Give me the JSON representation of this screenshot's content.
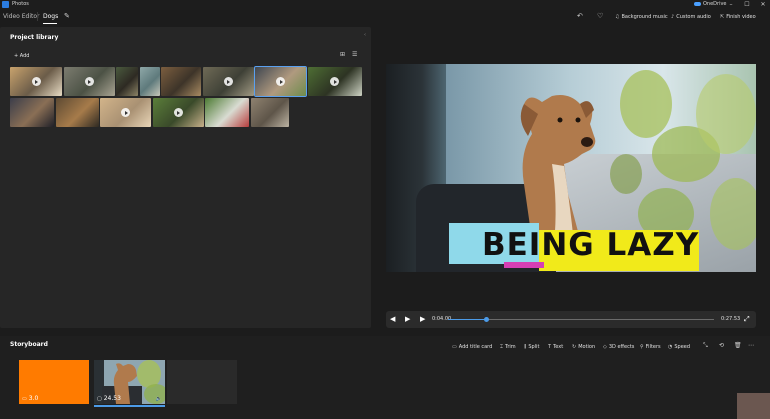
{
  "app": {
    "title": "Photos",
    "onedrive": "OneDrive"
  },
  "window_controls": {
    "minimize": "–",
    "maximize": "☐",
    "close": "✕"
  },
  "toolbar": {
    "breadcrumb_root": "Video Editor",
    "project_name": "Dogs",
    "undo_icon": "↶",
    "favorite_icon": "♡",
    "background_music": "Background music",
    "custom_audio": "Custom audio",
    "finish_video": "Finish video"
  },
  "library": {
    "title": "Project library",
    "add_label": "Add",
    "thumbnails": [
      {
        "colors": [
          "#c9a36d",
          "#6b5c49",
          "#e8dcc4"
        ],
        "play": true,
        "selected": false
      },
      {
        "colors": [
          "#7c7c70",
          "#4c5245",
          "#a9a493"
        ],
        "play": true,
        "selected": false
      },
      {
        "colors": [
          "#4a5a3e",
          "#2e2a23",
          "#8c8466"
        ],
        "play": false,
        "selected": false
      },
      {
        "colors": [
          "#8fa8a8",
          "#5e7a7c",
          "#c7c7b9"
        ],
        "play": false,
        "selected": false
      },
      {
        "colors": [
          "#7c5e3f",
          "#3d3429",
          "#a88a62"
        ],
        "play": false,
        "selected": false
      },
      {
        "colors": [
          "#6f6a56",
          "#3e4036",
          "#a19a84"
        ],
        "play": true,
        "selected": false
      },
      {
        "colors": [
          "#3e4650",
          "#b09a7f",
          "#6e8c4c"
        ],
        "play": true,
        "selected": true
      },
      {
        "colors": [
          "#4e6e34",
          "#2d3323",
          "#cfd4c5"
        ],
        "play": true,
        "selected": false
      },
      {
        "colors": [
          "#3b3d4a",
          "#8a6f55",
          "#1f2028"
        ],
        "play": false,
        "selected": false
      },
      {
        "colors": [
          "#5d4a33",
          "#a67b4a",
          "#2f2a22"
        ],
        "play": false,
        "selected": false
      },
      {
        "colors": [
          "#d2b48a",
          "#a99173",
          "#e9d6b8"
        ],
        "play": true,
        "selected": false
      },
      {
        "colors": [
          "#5b7e3a",
          "#3a4a2a",
          "#c7b08a"
        ],
        "play": true,
        "selected": false
      },
      {
        "colors": [
          "#4c7a33",
          "#d9dcd2",
          "#b73d3d"
        ],
        "play": false,
        "selected": false
      },
      {
        "colors": [
          "#8f8270",
          "#5e5549",
          "#bcb3a3"
        ],
        "play": false,
        "selected": false
      }
    ]
  },
  "preview": {
    "title_text": "BEING LAZY"
  },
  "transport": {
    "current_time": "0:04.00",
    "total_time": "0:27.53",
    "progress": 0.145
  },
  "storyboard": {
    "title": "Storyboard",
    "tools": {
      "add_title_card": "Add title card",
      "trim": "Trim",
      "split": "Split",
      "text": "Text",
      "motion": "Motion",
      "effects_3d": "3D effects",
      "filters": "Filters",
      "speed": "Speed"
    },
    "clips": [
      {
        "duration": "3.0",
        "type": "title-card",
        "color": "#ff7b00"
      },
      {
        "duration": "24.53",
        "type": "video",
        "selected": true
      }
    ]
  }
}
